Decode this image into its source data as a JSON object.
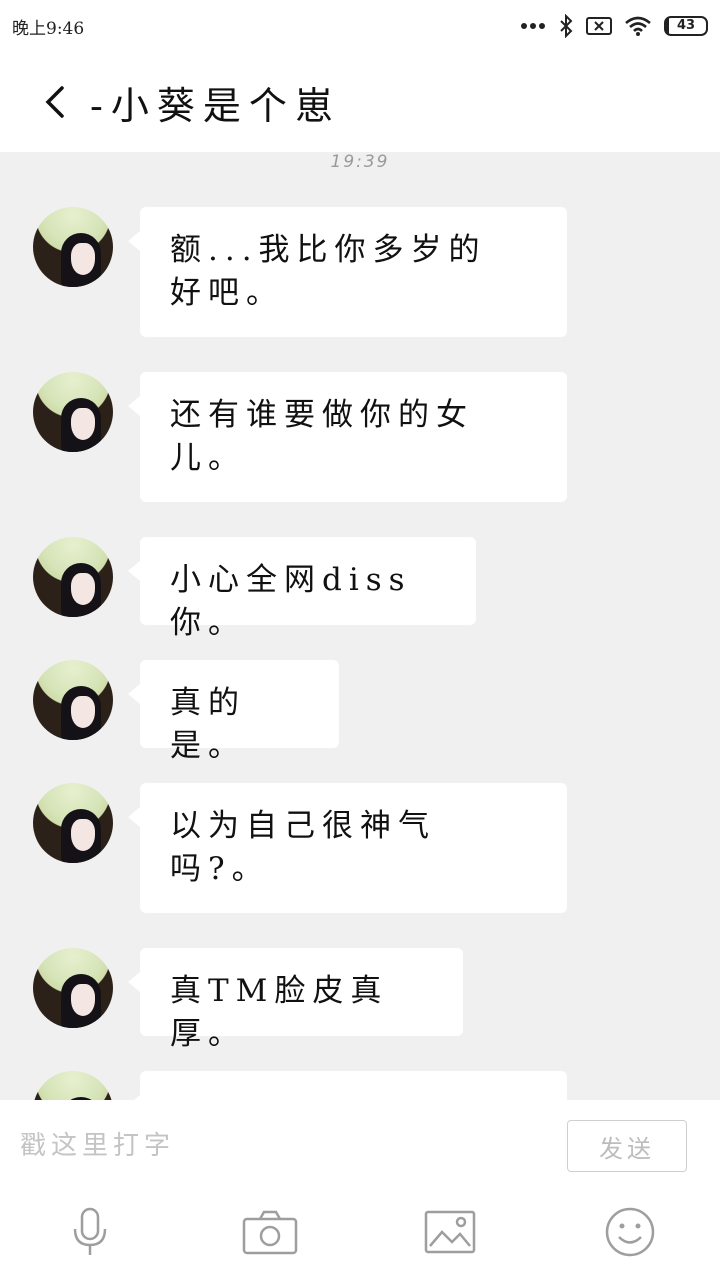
{
  "status_bar": {
    "time": "晚上9:46",
    "battery": "43"
  },
  "header": {
    "title": "-小葵是个崽"
  },
  "chat": {
    "timestamp": "19:39",
    "messages": [
      {
        "text": "额...我比你多岁的\n好吧。"
      },
      {
        "text": "还有谁要做你的女\n儿。"
      },
      {
        "text": "小心全网diss你。"
      },
      {
        "text": "真的是。"
      },
      {
        "text": "以为自己很神气\n吗?。"
      },
      {
        "text": "真TM脸皮真厚。"
      },
      {
        "text": ""
      }
    ]
  },
  "input_bar": {
    "placeholder": "戳这里打字",
    "send_label": "发送"
  },
  "icons": {
    "back": "chevron-left-icon",
    "mic": "microphone-icon",
    "camera": "camera-icon",
    "image": "image-icon",
    "emoji": "smiley-icon",
    "dots": "more-dots-icon",
    "bluetooth": "bluetooth-icon",
    "nosim": "no-sim-icon",
    "wifi": "wifi-icon",
    "battery": "battery-icon"
  }
}
